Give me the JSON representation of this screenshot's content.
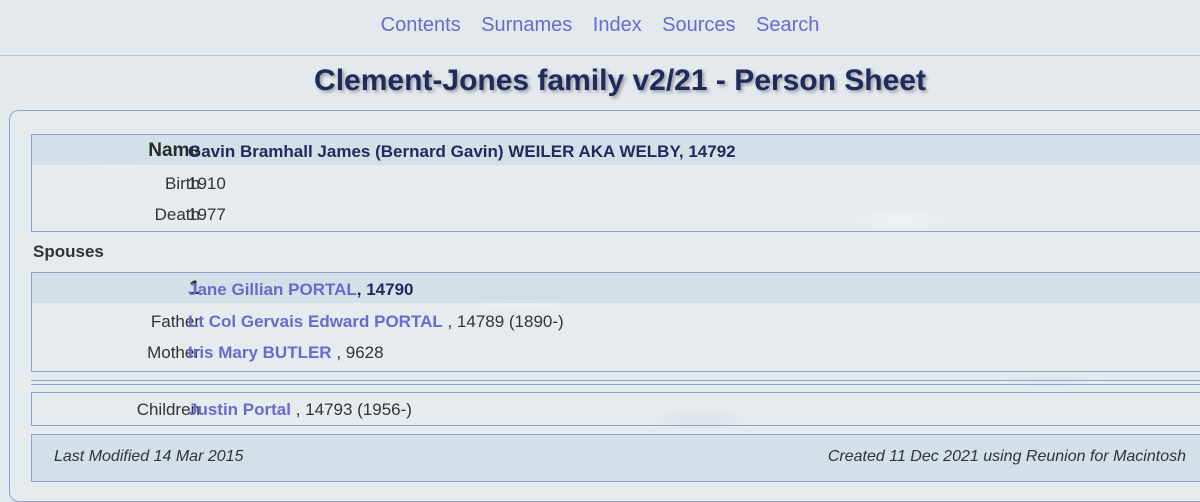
{
  "nav": {
    "items": [
      "Contents",
      "Surnames",
      "Index",
      "Sources",
      "Search"
    ]
  },
  "page_title": "Clement-Jones family v2/21 - Person Sheet",
  "person": {
    "name_label": "Name",
    "name_value": "Gavin Bramhall James (Bernard Gavin) WEILER AKA WELBY, 14792",
    "birth_label": "Birth",
    "birth_value": "1910",
    "death_label": "Death",
    "death_value": "1977"
  },
  "spouses": {
    "section_label": "Spouses",
    "number": "1",
    "spouse_name": "Jane Gillian PORTAL",
    "spouse_id": ", 14790",
    "father_label": "Father",
    "father_name": "Lt Col Gervais Edward PORTAL",
    "father_detail": " , 14789 (1890-)",
    "mother_label": "Mother",
    "mother_name": "Iris Mary BUTLER",
    "mother_detail": " , 9628"
  },
  "children": {
    "label": "Children",
    "child_name": "Justin Portal",
    "child_detail": " , 14793 (1956-)"
  },
  "footer": {
    "last_modified": "Last Modified 14 Mar 2015",
    "created": "Created 11 Dec 2021 using Reunion for Macintosh"
  }
}
